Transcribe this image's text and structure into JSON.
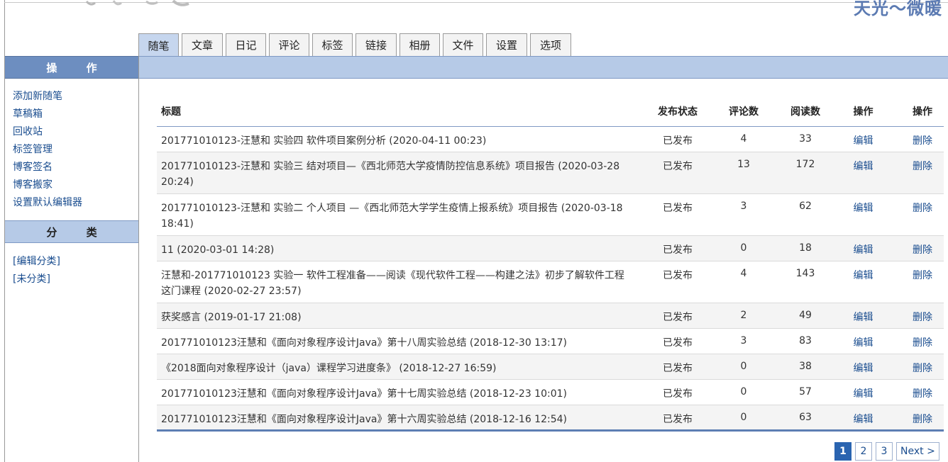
{
  "header": {
    "blog_title": "天光～微暖"
  },
  "tabs": [
    "随笔",
    "文章",
    "日记",
    "评论",
    "标签",
    "链接",
    "相册",
    "文件",
    "设置",
    "选项"
  ],
  "sidebar": {
    "ops_title": "操 作",
    "links": [
      "添加新随笔",
      "草稿箱",
      "回收站",
      "标签管理",
      "博客签名",
      "博客搬家",
      "设置默认编辑器"
    ],
    "category_title": "分 类",
    "category_links": [
      "[编辑分类]",
      "[未分类]"
    ]
  },
  "table": {
    "headers": [
      "标题",
      "发布状态",
      "评论数",
      "阅读数",
      "操作",
      "操作"
    ],
    "rows": [
      {
        "title": "201771010123-汪慧和 实验四 软件项目案例分析 (2020-04-11 00:23)",
        "status": "已发布",
        "comments": "4",
        "reads": "33",
        "edit": "编辑",
        "delete": "删除"
      },
      {
        "title": "201771010123-汪慧和 实验三 结对项目—《西北师范大学疫情防控信息系统》项目报告 (2020-03-28 20:24)",
        "status": "已发布",
        "comments": "13",
        "reads": "172",
        "edit": "编辑",
        "delete": "删除"
      },
      {
        "title": "201771010123-汪慧和 实验二 个人项目 —《西北师范大学学生疫情上报系统》项目报告 (2020-03-18 18:41)",
        "status": "已发布",
        "comments": "3",
        "reads": "62",
        "edit": "编辑",
        "delete": "删除"
      },
      {
        "title": "11 (2020-03-01 14:28)",
        "status": "已发布",
        "comments": "0",
        "reads": "18",
        "edit": "编辑",
        "delete": "删除"
      },
      {
        "title": "汪慧和-201771010123 实验一 软件工程准备——阅读《现代软件工程——构建之法》初步了解软件工程这门课程 (2020-02-27 23:57)",
        "status": "已发布",
        "comments": "4",
        "reads": "143",
        "edit": "编辑",
        "delete": "删除"
      },
      {
        "title": "获奖感言 (2019-01-17 21:08)",
        "status": "已发布",
        "comments": "2",
        "reads": "49",
        "edit": "编辑",
        "delete": "删除"
      },
      {
        "title": "201771010123汪慧和《面向对象程序设计Java》第十八周实验总结 (2018-12-30 13:17)",
        "status": "已发布",
        "comments": "3",
        "reads": "83",
        "edit": "编辑",
        "delete": "删除"
      },
      {
        "title": "《2018面向对象程序设计（java）课程学习进度条》 (2018-12-27 16:59)",
        "status": "已发布",
        "comments": "0",
        "reads": "38",
        "edit": "编辑",
        "delete": "删除"
      },
      {
        "title": "201771010123汪慧和《面向对象程序设计Java》第十七周实验总结 (2018-12-23 10:01)",
        "status": "已发布",
        "comments": "0",
        "reads": "57",
        "edit": "编辑",
        "delete": "删除"
      },
      {
        "title": "201771010123汪慧和《面向对象程序设计Java》第十六周实验总结 (2018-12-16 12:54)",
        "status": "已发布",
        "comments": "0",
        "reads": "63",
        "edit": "编辑",
        "delete": "删除"
      }
    ]
  },
  "pagination": {
    "pages": [
      "1",
      "2",
      "3"
    ],
    "current": "1",
    "next_label": "Next >"
  },
  "colors": {
    "accent": "#6d8ec0",
    "band": "#b6cae7",
    "link": "#1a4d8f",
    "current_page": "#2a64b0"
  }
}
